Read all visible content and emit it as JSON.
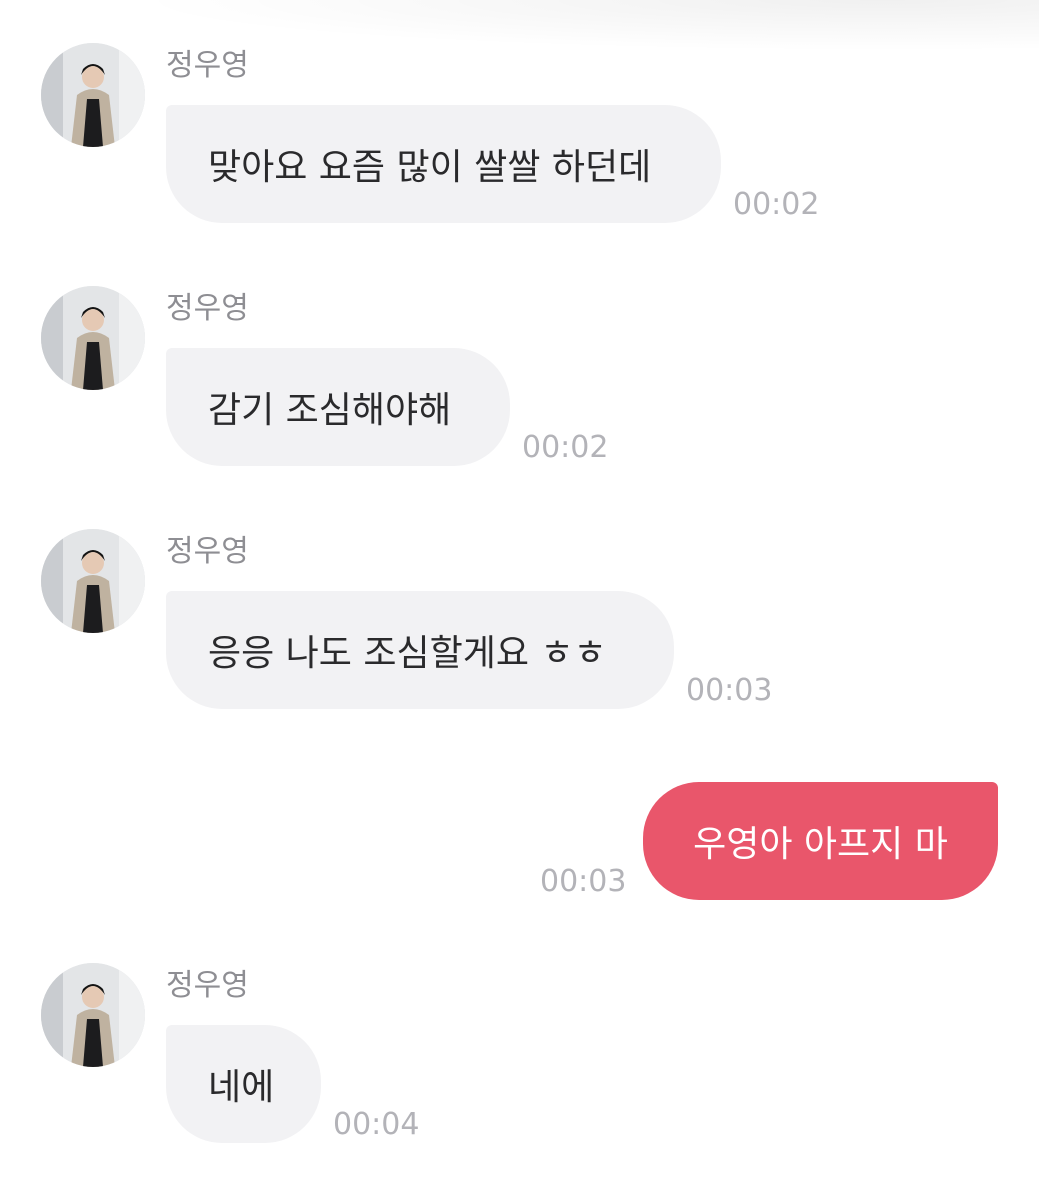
{
  "chat": {
    "avatar_icon": "profile-photo",
    "colors": {
      "incoming_bubble": "#f2f2f4",
      "outgoing_bubble": "#e9566b",
      "timestamp": "#b3b3b8",
      "sender_name": "#8e8e93"
    },
    "messages": [
      {
        "sender": "정우영",
        "text": "맞아요 요즘 많이 쌀쌀 하던데",
        "time": "00:02",
        "direction": "incoming"
      },
      {
        "sender": "정우영",
        "text": "감기 조심해야해",
        "time": "00:02",
        "direction": "incoming"
      },
      {
        "sender": "정우영",
        "text": "응응 나도 조심할게요 ㅎㅎ",
        "time": "00:03",
        "direction": "incoming"
      },
      {
        "text": "우영아 아프지 마",
        "time": "00:03",
        "direction": "outgoing"
      },
      {
        "sender": "정우영",
        "text": "네에",
        "time": "00:04",
        "direction": "incoming"
      }
    ]
  }
}
